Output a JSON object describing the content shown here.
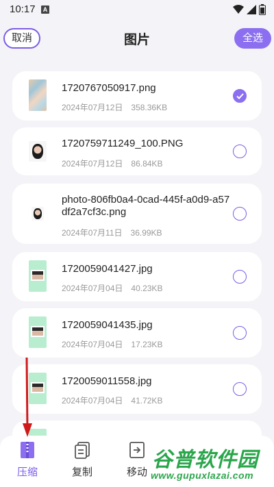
{
  "status_bar": {
    "time": "10:17",
    "notification_letter": "A"
  },
  "header": {
    "cancel_label": "取消",
    "title": "图片",
    "select_all_label": "全选"
  },
  "files": [
    {
      "name": "1720767050917.png",
      "date": "2024年07月12日",
      "size": "358.36KB",
      "selected": true
    },
    {
      "name": "1720759711249_100.PNG",
      "date": "2024年07月12日",
      "size": "86.84KB",
      "selected": false
    },
    {
      "name": "photo-806fb0a4-0cad-445f-a0d9-a57df2a7cf3c.png",
      "date": "2024年07月11日",
      "size": "36.99KB",
      "selected": false
    },
    {
      "name": "1720059041427.jpg",
      "date": "2024年07月04日",
      "size": "40.23KB",
      "selected": false
    },
    {
      "name": "1720059041435.jpg",
      "date": "2024年07月04日",
      "size": "17.23KB",
      "selected": false
    },
    {
      "name": "1720059011558.jpg",
      "date": "2024年07月04日",
      "size": "41.72KB",
      "selected": false
    }
  ],
  "bottom_tabs": [
    {
      "label": "压缩",
      "icon": "zip-icon",
      "active": true
    },
    {
      "label": "复制",
      "icon": "copy-icon",
      "active": false
    },
    {
      "label": "移动",
      "icon": "move-icon",
      "active": false
    }
  ],
  "watermark": {
    "name": "谷普软件园",
    "url": "www.gupuxlazai.com"
  },
  "colors": {
    "accent": "#8b6ff0",
    "background": "#f4f4f8",
    "watermark": "#2aa64b",
    "arrow": "#d0191b"
  }
}
